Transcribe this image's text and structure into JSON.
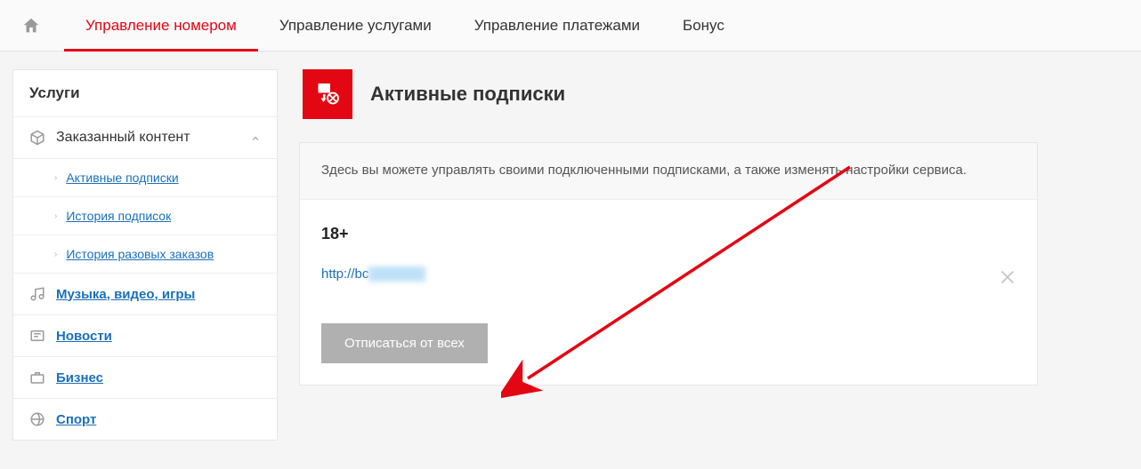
{
  "topnav": {
    "tabs": [
      {
        "label": "Управление номером",
        "active": true
      },
      {
        "label": "Управление услугами",
        "active": false
      },
      {
        "label": "Управление платежами",
        "active": false
      },
      {
        "label": "Бонус",
        "active": false
      }
    ]
  },
  "sidebar": {
    "header": "Услуги",
    "group": {
      "label": "Заказанный контент"
    },
    "subitems": [
      {
        "label": "Активные подписки"
      },
      {
        "label": "История подписок"
      },
      {
        "label": "История разовых заказов"
      }
    ],
    "links": [
      {
        "label": "Музыка, видео, игры"
      },
      {
        "label": "Новости"
      },
      {
        "label": "Бизнес"
      },
      {
        "label": "Спорт"
      }
    ]
  },
  "main": {
    "title": "Активные подписки",
    "note": "Здесь вы можете управлять своими подключенными подписками, а также изменять настройки сервиса.",
    "subscription_title": "18+",
    "subscription_url_prefix": "http://bc",
    "unsubscribe_label": "Отписаться от всех"
  }
}
